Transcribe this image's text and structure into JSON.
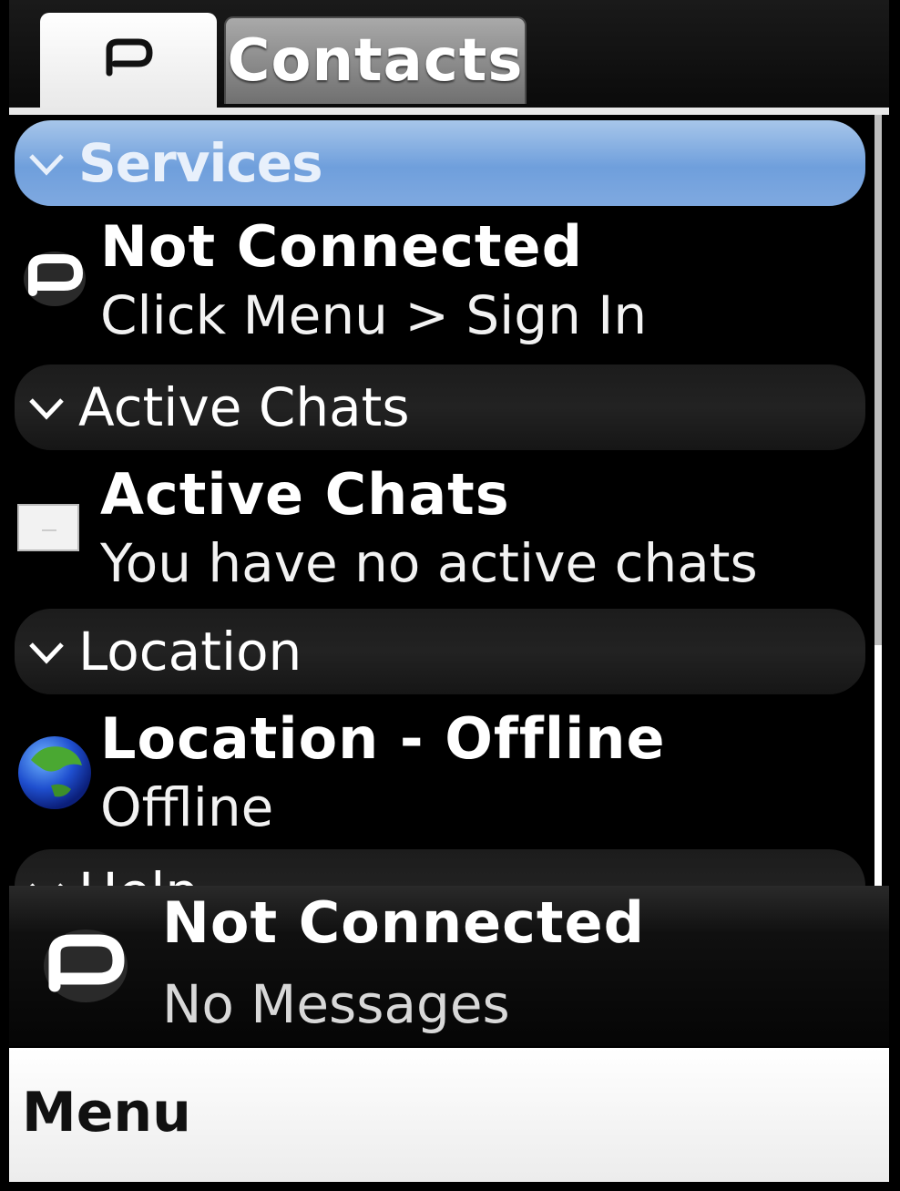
{
  "tabs": {
    "home_icon": "pidgin-logo-icon",
    "contacts_label": "Contacts"
  },
  "sections": [
    {
      "header": "Services",
      "selected": true,
      "item": {
        "icon": "pidgin-logo-icon",
        "title": "Not Connected",
        "subtitle": "Click Menu > Sign In"
      }
    },
    {
      "header": "Active Chats",
      "selected": false,
      "item": {
        "icon": "chat-window-icon",
        "title": "Active Chats",
        "subtitle": "You have no active chats"
      }
    },
    {
      "header": "Location",
      "selected": false,
      "item": {
        "icon": "globe-icon",
        "title": "Location - Offline",
        "subtitle": "Offline"
      }
    },
    {
      "header": "Help",
      "selected": false
    }
  ],
  "status": {
    "icon": "pidgin-logo-icon",
    "title": "Not Connected",
    "subtitle": "No Messages"
  },
  "softkeys": {
    "left": "Menu"
  },
  "colors": {
    "selected_header": "#7fa9e0",
    "background": "#000000"
  }
}
